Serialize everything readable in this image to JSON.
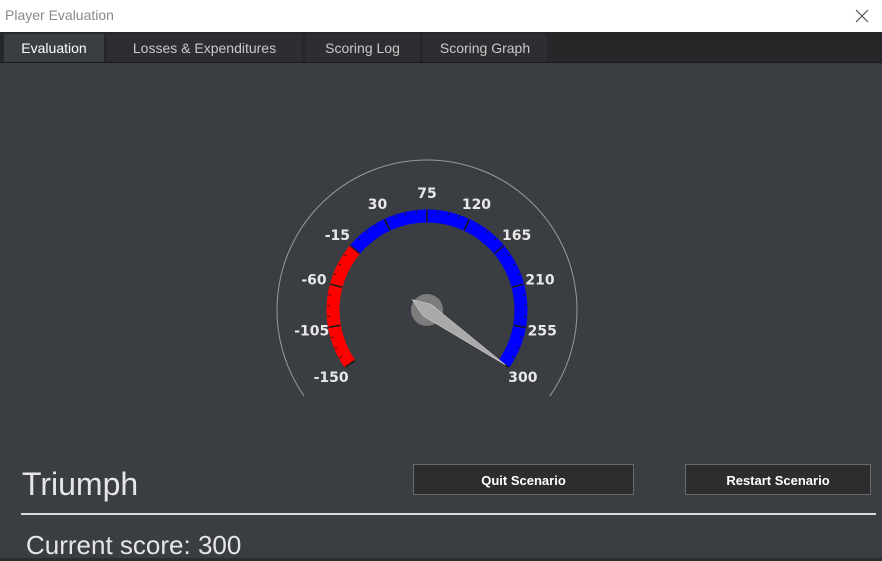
{
  "window": {
    "title": "Player Evaluation",
    "close_icon": "close-icon"
  },
  "tabs": [
    {
      "label": "Evaluation",
      "active": true
    },
    {
      "label": "Losses & Expenditures",
      "active": false
    },
    {
      "label": "Scoring Log",
      "active": false
    },
    {
      "label": "Scoring Graph",
      "active": false
    }
  ],
  "gauge": {
    "min": -150,
    "max": 300,
    "value": 300,
    "tick_labels": [
      "-150",
      "-105",
      "-60",
      "-15",
      "30",
      "75",
      "120",
      "165",
      "210",
      "255",
      "300"
    ],
    "negative_color": "#ff0000",
    "positive_color": "#0000ff"
  },
  "result": {
    "label": "Triumph"
  },
  "score": {
    "label": "Current score: 300"
  },
  "buttons": {
    "quit_label": "Quit Scenario",
    "restart_label": "Restart Scenario"
  }
}
